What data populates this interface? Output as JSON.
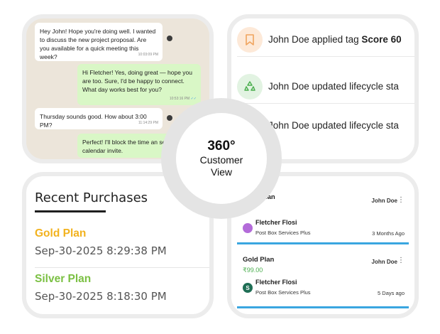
{
  "chat": {
    "messages": [
      {
        "direction": "in",
        "text": "Hey John! Hope you're doing well. I wanted to discuss the new project proposal. Are you available for a quick meeting this week?",
        "time": "10:03:09 PM"
      },
      {
        "direction": "out",
        "text": "Hi Fletcher! Yes, doing great — hope you are too. Sure, I'd be happy to connect. What day works best for you?",
        "time": "10:53:16 PM"
      },
      {
        "direction": "in",
        "text": "Thursday sounds good. How about 3:00 PM?",
        "time": "11:14:29 PM"
      },
      {
        "direction": "out",
        "text": "Perfect! I'll block the time an send you a calendar invite.",
        "time": ""
      }
    ]
  },
  "activity": {
    "items": [
      {
        "prefix": "John Doe applied tag ",
        "bold": "Score 60",
        "icon": "bookmark-icon",
        "icon_color": "#f0a45e",
        "icon_bg": "#fde9d8"
      },
      {
        "prefix": "John Doe updated lifecycle sta",
        "bold": "",
        "icon": "recycle-icon",
        "icon_color": "#4caf50",
        "icon_bg": "#e2f3e2"
      },
      {
        "prefix": "John Doe updated lifecycle sta",
        "bold": "",
        "icon": "",
        "icon_color": "",
        "icon_bg": ""
      }
    ]
  },
  "purchases": {
    "title": "Recent Purchases",
    "items": [
      {
        "plan": "Gold Plan",
        "date": "Sep-30-2025 8:29:38 PM",
        "color": "#f2b21e"
      },
      {
        "plan": "Silver Plan",
        "date": "Sep-30-2025 8:18:30 PM",
        "color": "#7bc043"
      }
    ]
  },
  "cards": [
    {
      "title": "lan",
      "price": "",
      "user": "John Doe",
      "contact": "Fletcher Flosi",
      "company": "Post Box Services Plus",
      "age": "3 Months Ago",
      "avatar_letter": "",
      "avatar_color": "#b36bd9"
    },
    {
      "title": "Gold Plan",
      "price": "₹99.00",
      "user": "John Doe",
      "contact": "Fletcher Flosi",
      "company": "Post Box Services Plus",
      "age": "5 Days ago",
      "avatar_letter": "S",
      "avatar_color": "#1f6e55"
    }
  ],
  "center": {
    "title": "360°",
    "line1": "Customer",
    "line2": "View"
  }
}
